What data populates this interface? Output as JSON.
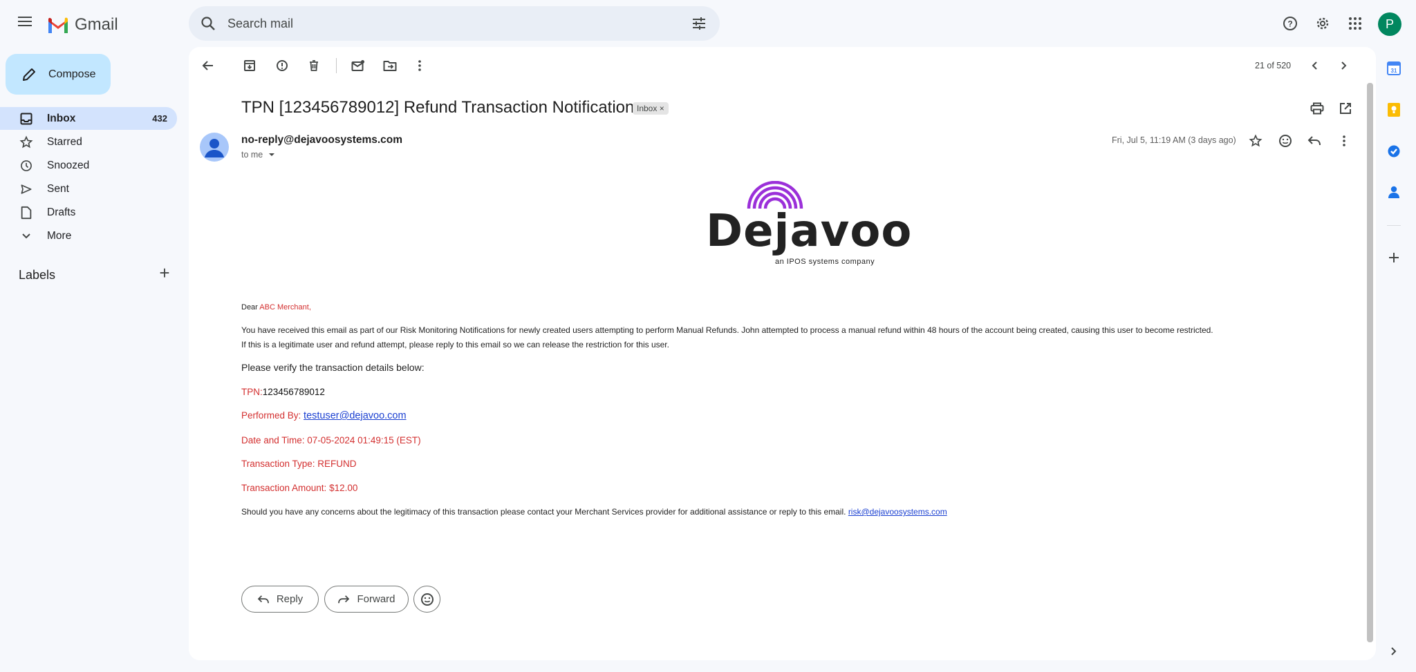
{
  "app": {
    "name": "Gmail",
    "account_initial": "P"
  },
  "search": {
    "placeholder": "Search mail"
  },
  "compose": {
    "label": "Compose"
  },
  "nav": [
    {
      "label": "Inbox",
      "count": "432"
    },
    {
      "label": "Starred",
      "count": ""
    },
    {
      "label": "Snoozed",
      "count": ""
    },
    {
      "label": "Sent",
      "count": ""
    },
    {
      "label": "Drafts",
      "count": ""
    },
    {
      "label": "More",
      "count": ""
    }
  ],
  "labels": {
    "title": "Labels",
    "add": "+"
  },
  "toolbar": {
    "pager": "21 of 520"
  },
  "email": {
    "subject": "TPN [123456789012] Refund Transaction Notification",
    "chip": "Inbox ×",
    "sender": "no-reply@dejavoosystems.com",
    "to": "to me",
    "date": "Fri, Jul 5, 11:19 AM (3 days ago)",
    "logo_brand": "Dejavoo",
    "logo_tagline": "an IPOS systems company",
    "greeting_prefix": "Dear ",
    "greeting_name": "ABC Merchant,",
    "para1": "You have received this email as part of our Risk Monitoring Notifications for newly created users attempting to perform Manual Refunds. John attempted to process a manual refund within 48 hours of the account being created, causing this user to become restricted.",
    "para2": "If this is a legitimate user and refund attempt, please reply to this email so we can release the restriction for this user.",
    "verify": "Please verify the transaction details below:",
    "tpn_label": "TPN:",
    "tpn_value": "123456789012",
    "performed_label": "Performed By:",
    "performed_value": "testuser@dejavoo.com",
    "datetime": "Date and Time: 07-05-2024 01:49:15 (EST)",
    "txn_type": "Transaction Type: REFUND",
    "txn_amount": "Transaction Amount: $12.00",
    "closing": "Should you have any concerns about the legitimacy of this transaction please contact your Merchant Services provider for additional assistance or reply to this email.",
    "closing_link": "risk@dejavoosystems.com"
  },
  "actions": {
    "reply": "Reply",
    "forward": "Forward"
  },
  "colors": {
    "accent": "#c2e7ff",
    "active_nav": "#d3e3fd",
    "alert_red": "#d32f2f",
    "logo_purple": "#9b30d9"
  }
}
